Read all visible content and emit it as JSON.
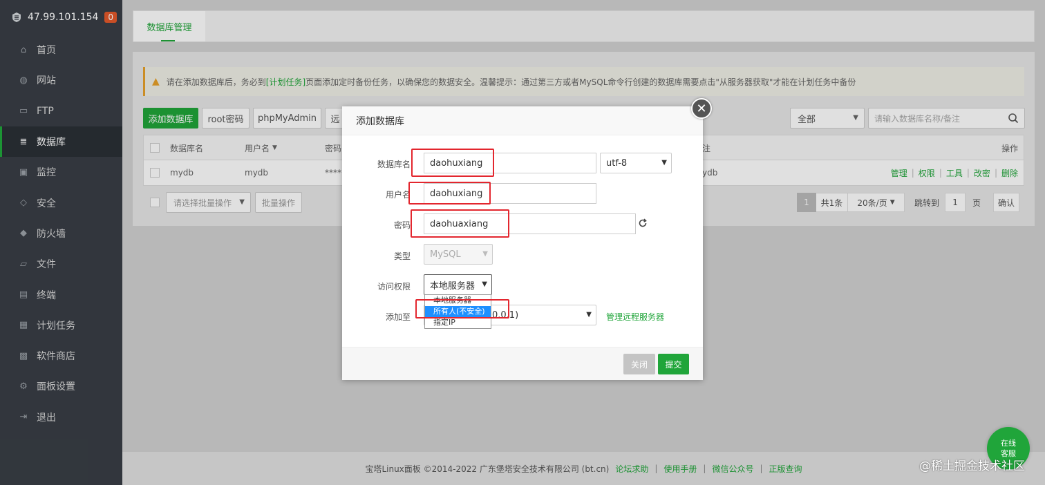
{
  "sidebar": {
    "server_ip": "47.99.101.154",
    "badge": "0",
    "items": [
      {
        "label": "首页",
        "icon": "home-icon"
      },
      {
        "label": "网站",
        "icon": "globe-icon"
      },
      {
        "label": "FTP",
        "icon": "ftp-icon"
      },
      {
        "label": "数据库",
        "icon": "database-icon",
        "active": true
      },
      {
        "label": "监控",
        "icon": "monitor-icon"
      },
      {
        "label": "安全",
        "icon": "shield-icon"
      },
      {
        "label": "防火墙",
        "icon": "firewall-icon"
      },
      {
        "label": "文件",
        "icon": "folder-icon"
      },
      {
        "label": "终端",
        "icon": "terminal-icon"
      },
      {
        "label": "计划任务",
        "icon": "calendar-icon"
      },
      {
        "label": "软件商店",
        "icon": "grid-icon"
      },
      {
        "label": "面板设置",
        "icon": "settings-icon"
      },
      {
        "label": "退出",
        "icon": "logout-icon"
      }
    ]
  },
  "tab": {
    "label": "数据库管理"
  },
  "notice": {
    "prefix": "请在添加数据库后，务必到",
    "link": "[计划任务]",
    "suffix": "页面添加定时备份任务，以确保您的数据安全。温馨提示：通过第三方或者MySQL命令行创建的数据库需要点击\"从服务器获取\"才能在计划任务中备份"
  },
  "toolbar": {
    "add_db": "添加数据库",
    "root_pwd": "root密码",
    "phpmyadmin": "phpMyAdmin",
    "remote": "远",
    "filter_value": "全部",
    "search_placeholder": "请输入数据库名称/备注"
  },
  "table": {
    "headers": {
      "name": "数据库名",
      "user": "用户名",
      "pwd": "密码",
      "note": "注",
      "ops": "操作"
    },
    "rows": [
      {
        "name": "mydb",
        "user": "mydb",
        "pwd": "****",
        "note": "ydb"
      }
    ],
    "ops": [
      "管理",
      "权限",
      "工具",
      "改密",
      "删除"
    ]
  },
  "batch": {
    "select_placeholder": "请选择批量操作",
    "button": "批量操作"
  },
  "pager": {
    "current": "1",
    "total": "共1条",
    "per_page": "20条/页",
    "jump_label": "跳转到",
    "jump_value": "1",
    "page_unit": "页",
    "confirm": "确认"
  },
  "footer": {
    "copyright": "宝塔Linux面板 ©2014-2022 广东堡塔安全技术有限公司 (bt.cn)",
    "links": [
      "论坛求助",
      "使用手册",
      "微信公众号",
      "正版查询"
    ]
  },
  "modal": {
    "title": "添加数据库",
    "labels": {
      "db_name": "数据库名",
      "user": "用户名",
      "password": "密码",
      "type": "类型",
      "access": "访问权限",
      "add_to": "添加至"
    },
    "values": {
      "db_name": "daohuxiang",
      "charset": "utf-8",
      "user": "daohuxiang",
      "password": "daohuaxiang",
      "type": "MySQL",
      "access": "本地服务器",
      "add_to_partial": "0.0.1)"
    },
    "manage_remote": "管理远程服务器",
    "dropdown_options": [
      "本地服务器",
      "所有人(不安全)",
      "指定IP"
    ],
    "dropdown_selected_index": 1,
    "close_btn": "关闭",
    "submit_btn": "提交"
  },
  "chat": {
    "line1": "在线",
    "line2": "客服"
  },
  "watermark": "@稀土掘金技术社区",
  "colors": {
    "accent": "#20a53a",
    "sidebar_bg": "#383d44",
    "highlight": "#e3262e"
  }
}
